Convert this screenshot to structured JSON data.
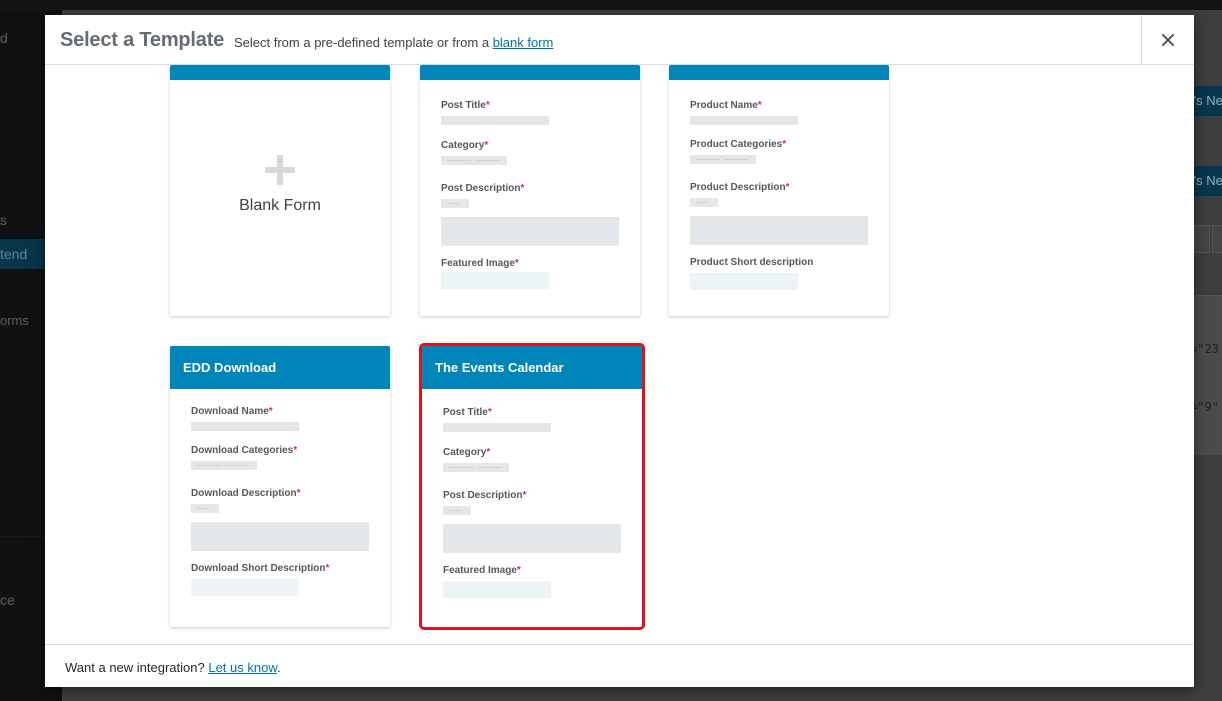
{
  "background": {
    "sidebar_items": [
      "d",
      "s",
      "tend",
      "orms",
      "ce"
    ],
    "right_buttons": [
      "t's Ne",
      "t's Ne"
    ],
    "right_code": [
      "=\"23",
      "=\"9\""
    ]
  },
  "modal": {
    "title": "Select a Template",
    "subtitle_prefix": "Select from a pre-defined template or from a",
    "subtitle_link": "blank form",
    "close_icon": "close-icon"
  },
  "templates": [
    {
      "name": "",
      "kind": "blank",
      "label": "Blank Form",
      "icon": "plus-icon"
    },
    {
      "name": "",
      "kind": "post",
      "fields": [
        "Post Title",
        "Category",
        "Post Description",
        "Featured Image"
      ]
    },
    {
      "name": "",
      "kind": "product",
      "fields": [
        "Product Name",
        "Product Categories",
        "Product Description",
        "Product Short description"
      ]
    },
    {
      "name": "EDD Download",
      "kind": "download",
      "fields": [
        "Download Name",
        "Download Categories",
        "Download Description",
        "Download Short Description"
      ]
    },
    {
      "name": "The Events Calendar",
      "kind": "events",
      "selected": true,
      "fields": [
        "Post Title",
        "Category",
        "Post Description",
        "Featured Image"
      ]
    }
  ],
  "required_marker": "*",
  "footer": {
    "text_prefix": "Want a new integration?",
    "link": "Let us know",
    "text_suffix": "."
  }
}
